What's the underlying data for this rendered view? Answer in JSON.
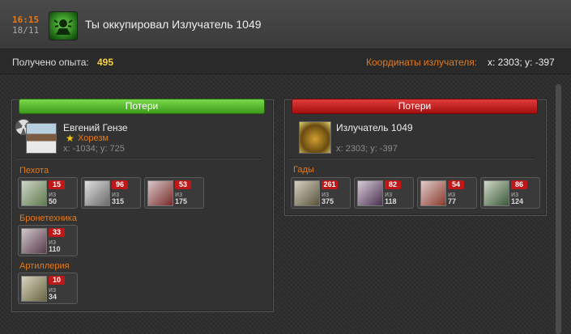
{
  "header": {
    "time": "16:15",
    "date": "18/11",
    "icon": "radiation-emitter-icon",
    "title": "Ты оккупировал Излучатель 1049"
  },
  "info": {
    "exp_label": "Получено опыта:",
    "exp_value": "495",
    "coord_label": "Координаты излучателя:",
    "coord_value": "x: 2303; y: -397"
  },
  "colors": {
    "accent_orange": "#e07a1e",
    "exp_yellow": "#f5d04a",
    "loss_badge": "#c01818",
    "left_bar_green": "#5cbf2a",
    "right_bar_red": "#c41c1c"
  },
  "left": {
    "bar_label": "Потери",
    "player": {
      "name": "Евгений Гензе",
      "clan": "Хорезм",
      "coords": "x: -1034; y: 725"
    },
    "categories": [
      {
        "name": "Пехота",
        "units": [
          {
            "lost": "15",
            "of": "из",
            "total": "50"
          },
          {
            "lost": "96",
            "of": "из",
            "total": "315"
          },
          {
            "lost": "53",
            "of": "из",
            "total": "175"
          }
        ]
      },
      {
        "name": "Бронетехника",
        "units": [
          {
            "lost": "33",
            "of": "из",
            "total": "110"
          }
        ]
      },
      {
        "name": "Артиллерия",
        "units": [
          {
            "lost": "10",
            "of": "из",
            "total": "34"
          }
        ]
      }
    ]
  },
  "right": {
    "bar_label": "Потери",
    "player": {
      "name": "Излучатель 1049",
      "coords": "x: 2303; y: -397"
    },
    "categories": [
      {
        "name": "Гады",
        "units": [
          {
            "lost": "261",
            "of": "из",
            "total": "375"
          },
          {
            "lost": "82",
            "of": "из",
            "total": "118"
          },
          {
            "lost": "54",
            "of": "из",
            "total": "77"
          },
          {
            "lost": "86",
            "of": "из",
            "total": "124"
          }
        ]
      }
    ]
  }
}
